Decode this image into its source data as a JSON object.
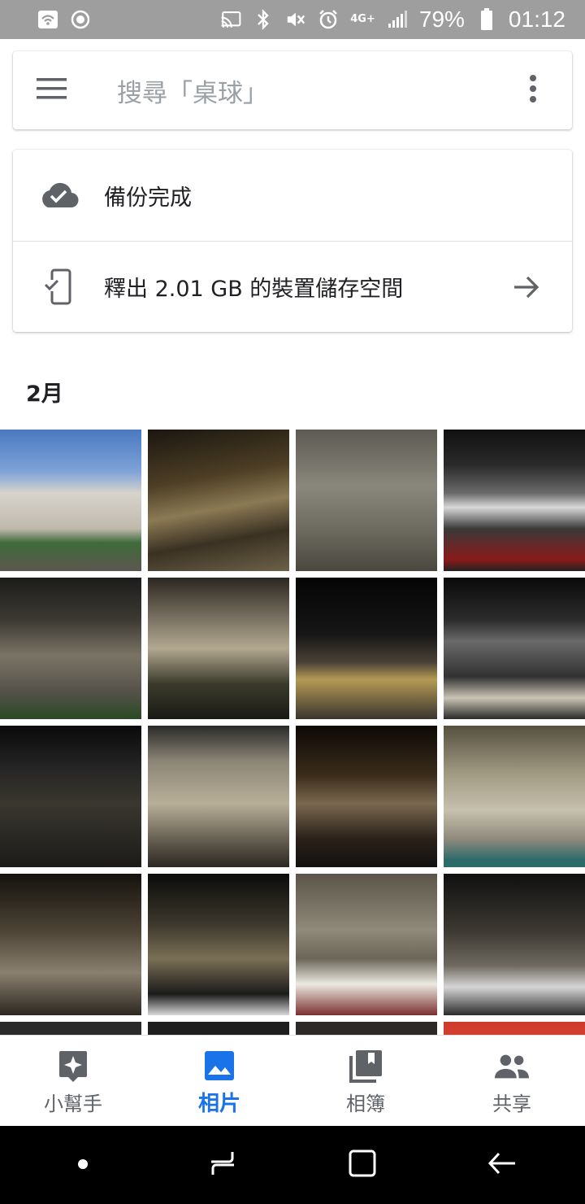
{
  "status_bar": {
    "battery": "79%",
    "time": "01:12",
    "network": "4G+"
  },
  "search": {
    "placeholder": "搜尋「桌球」"
  },
  "backup": {
    "status_label": "備份完成",
    "free_space_label": "釋出 2.01 GB 的裝置儲存空間"
  },
  "timeline": {
    "month": "2月"
  },
  "photos": [
    {
      "id": "p1"
    },
    {
      "id": "p2"
    },
    {
      "id": "p3"
    },
    {
      "id": "p4"
    },
    {
      "id": "p5"
    },
    {
      "id": "p6"
    },
    {
      "id": "p7"
    },
    {
      "id": "p8"
    },
    {
      "id": "p9"
    },
    {
      "id": "p10"
    },
    {
      "id": "p11"
    },
    {
      "id": "p12"
    },
    {
      "id": "p13"
    },
    {
      "id": "p14"
    },
    {
      "id": "p15"
    },
    {
      "id": "p16"
    }
  ],
  "bottom_nav": {
    "items": [
      {
        "label": "小幫手",
        "icon": "assistant-icon"
      },
      {
        "label": "相片",
        "icon": "photos-icon",
        "active": true
      },
      {
        "label": "相簿",
        "icon": "albums-icon"
      },
      {
        "label": "共享",
        "icon": "sharing-icon"
      }
    ]
  },
  "colors": {
    "accent": "#1a73e8",
    "status_bar": "#9e9e9e",
    "icon_gray": "#5f6368"
  }
}
